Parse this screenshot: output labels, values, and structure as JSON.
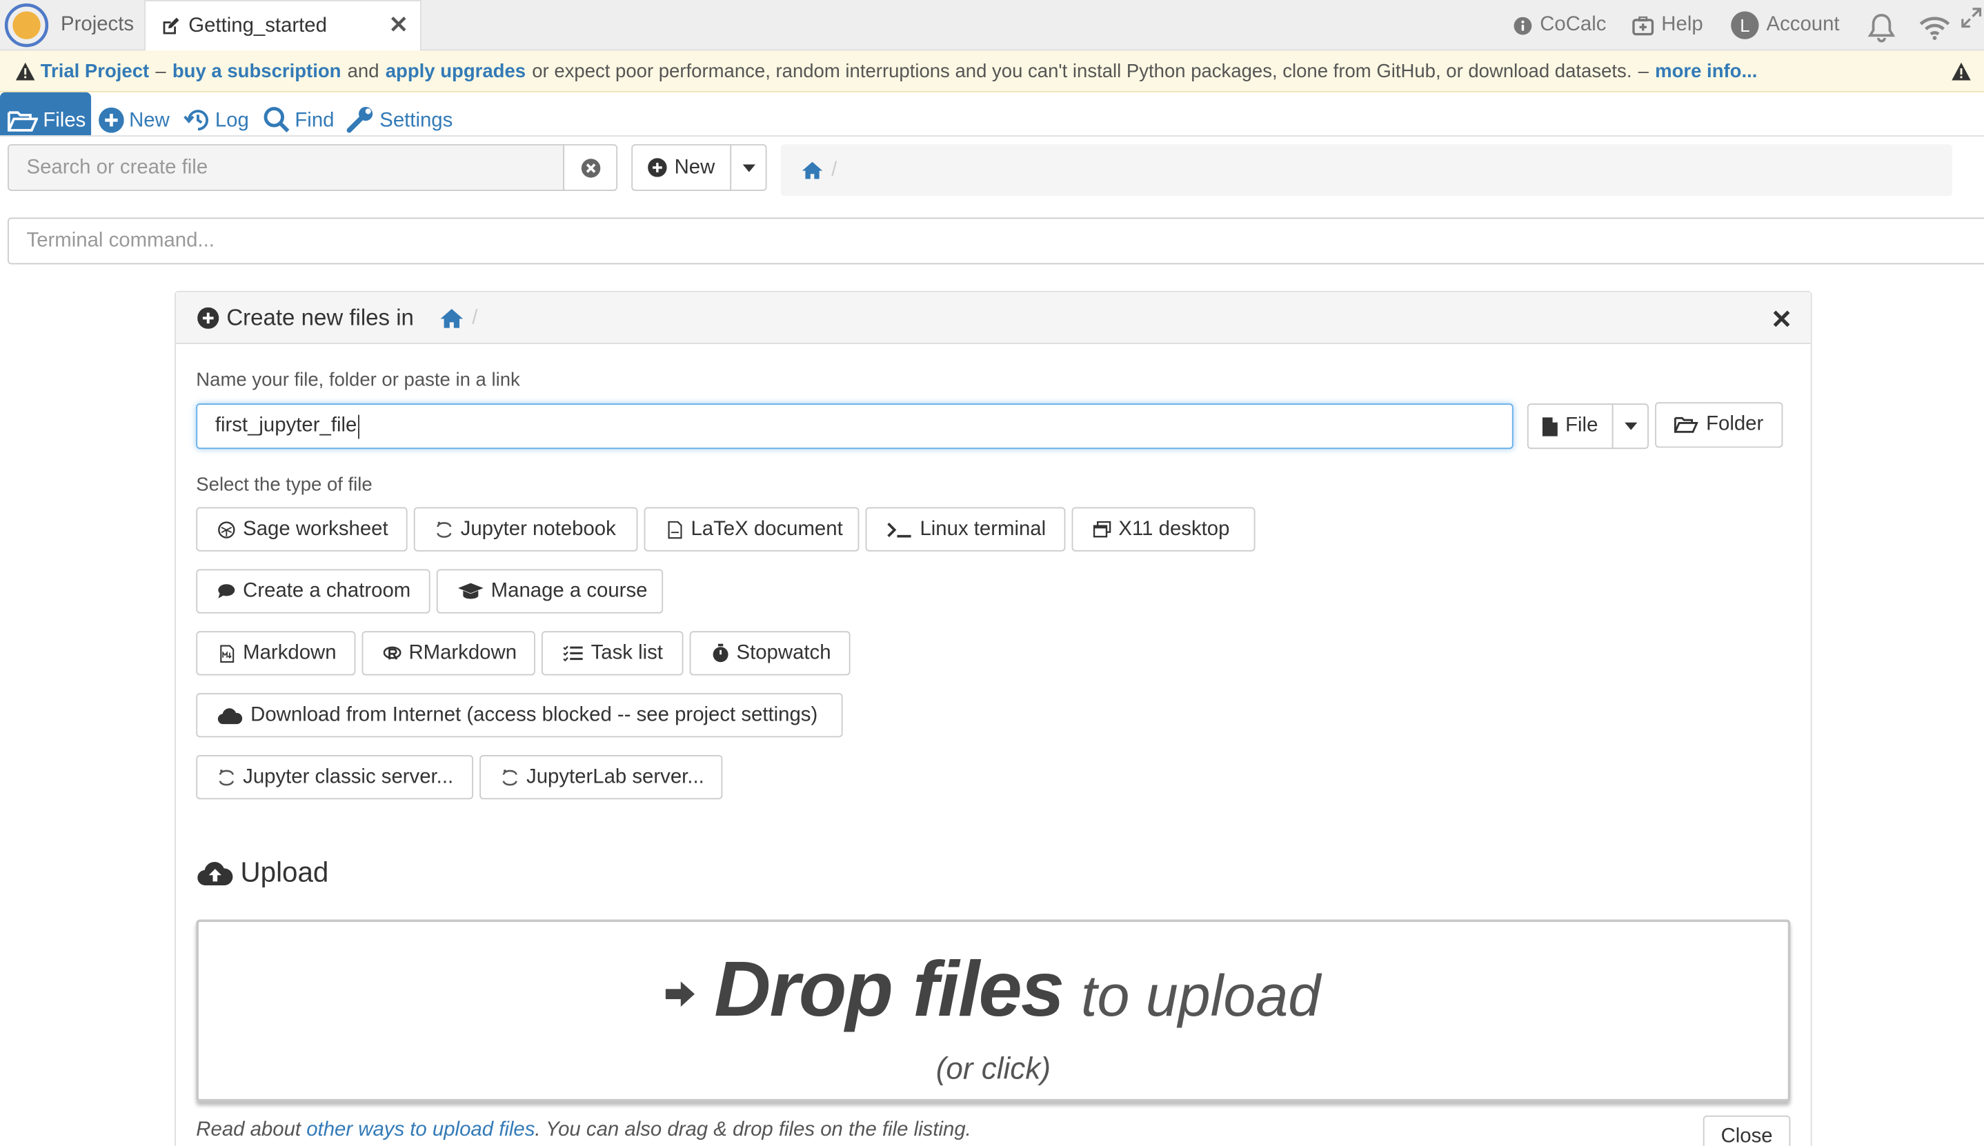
{
  "tabs": {
    "projects_label": "Projects",
    "getting_started_label": "Getting_started"
  },
  "topbar": {
    "cocalc_label": "CoCalc",
    "help_label": "Help",
    "account_label": "Account",
    "account_initial": "L"
  },
  "banner": {
    "trial_project": "Trial Project",
    "dash1": "–",
    "buy_subscription": "buy a subscription",
    "and": "and",
    "apply_upgrades": "apply upgrades",
    "message": "or expect poor performance, random interruptions and you can't install Python packages, clone from GitHub, or download datasets.",
    "dash2": "–",
    "more_info": "more info..."
  },
  "file_nav": {
    "files": "Files",
    "new": "New",
    "log": "Log",
    "find": "Find",
    "settings": "Settings"
  },
  "search": {
    "placeholder": "Search or create file",
    "new_button": "New"
  },
  "breadcrumb": {
    "separator": "/"
  },
  "terminal": {
    "placeholder": "Terminal command..."
  },
  "create_panel": {
    "title": "Create new files in",
    "separator": "/",
    "name_label": "Name your file, folder or paste in a link",
    "name_value": "first_jupyter_file",
    "file_button": "File",
    "folder_button": "Folder",
    "type_label": "Select the type of file",
    "types": {
      "sage": "Sage worksheet",
      "jupyter": "Jupyter notebook",
      "latex": "LaTeX document",
      "linux": "Linux terminal",
      "x11": "X11 desktop",
      "chatroom": "Create a chatroom",
      "course": "Manage a course",
      "markdown": "Markdown",
      "rmarkdown": "RMarkdown",
      "tasklist": "Task list",
      "stopwatch": "Stopwatch",
      "download": "Download from Internet (access blocked -- see project settings)",
      "jupyter_classic": "Jupyter classic server...",
      "jupyterlab": "JupyterLab server..."
    }
  },
  "upload": {
    "title": "Upload",
    "drop_bold": "Drop files",
    "drop_light": "to upload",
    "or_click": "(or click)",
    "read_about": "Read about",
    "other_ways_link": "other ways to upload files",
    "rest": ". You can also drag & drop files on the file listing.",
    "close_button": "Close"
  },
  "colors": {
    "link_blue": "#337ab7",
    "banner_bg": "#fcf8e3",
    "logo_orange": "#f0b240",
    "focus_border": "#66afe9"
  }
}
